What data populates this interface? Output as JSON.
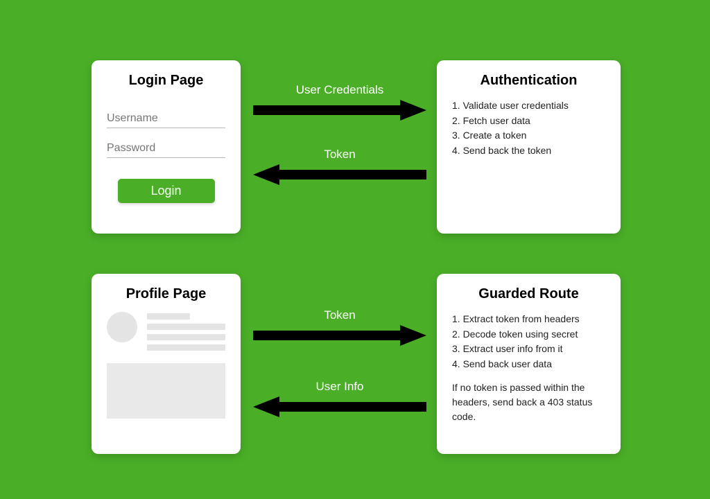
{
  "login": {
    "title": "Login Page",
    "username_placeholder": "Username",
    "password_placeholder": "Password",
    "button_label": "Login"
  },
  "auth": {
    "title": "Authentication",
    "steps": [
      "1. Validate user credentials",
      "2. Fetch user data",
      "3. Create a token",
      "4. Send back the token"
    ]
  },
  "profile": {
    "title": "Profile Page"
  },
  "guard": {
    "title": "Guarded Route",
    "steps": [
      "1. Extract token from headers",
      "2. Decode token using secret",
      "3. Extract user info from it",
      "4. Send back user data"
    ],
    "note": "If no token is passed within the headers, send back a 403 status code."
  },
  "arrows": {
    "top_right": "User Credentials",
    "top_left": "Token",
    "bottom_right": "Token",
    "bottom_left": "User Info"
  }
}
